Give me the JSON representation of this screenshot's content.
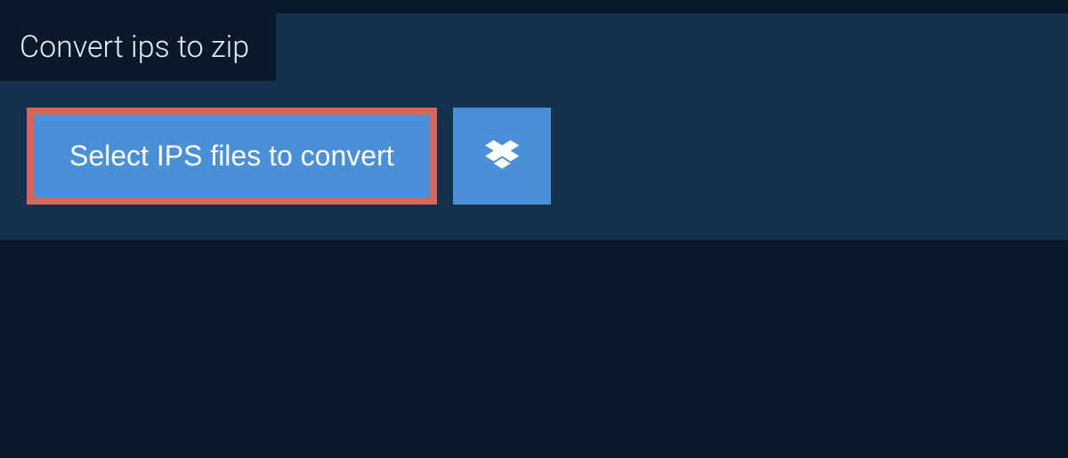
{
  "tab": {
    "title": "Convert ips to zip"
  },
  "buttons": {
    "select_label": "Select IPS files to convert"
  }
}
